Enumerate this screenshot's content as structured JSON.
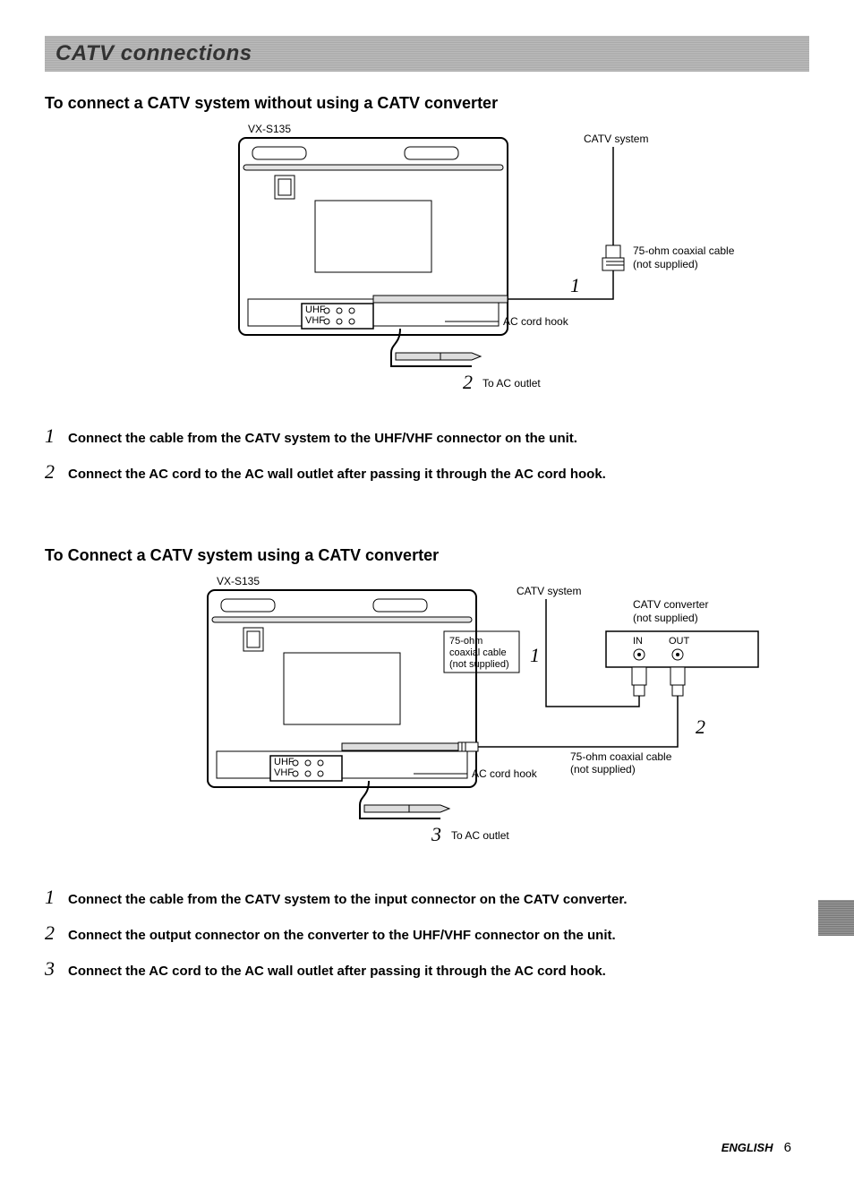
{
  "titleBar": "CATV connections",
  "section1": {
    "heading": "To connect a CATV system without using a CATV converter",
    "diagram": {
      "modelLabel": "VX-S135",
      "catvSystemLabel": "CATV system",
      "coaxLabel1": "75-ohm coaxial cable",
      "coaxLabel2": "(not supplied)",
      "cordHookLabel": "AC cord hook",
      "toAcOutletLabel": "To AC outlet",
      "stepMarker1": "1",
      "stepMarker2": "2",
      "uhfLabel": "UHF",
      "vhfLabel": "VHF"
    },
    "steps": [
      {
        "n": "1",
        "text": "Connect the cable from the CATV system to the UHF/VHF connector on the unit."
      },
      {
        "n": "2",
        "text": "Connect the AC cord to the AC wall outlet after passing it through the AC cord hook."
      }
    ]
  },
  "section2": {
    "heading": "To Connect a CATV system using a CATV converter",
    "diagram": {
      "modelLabel": "VX-S135",
      "catvSystemLabel": "CATV system",
      "converterLabel1": "CATV converter",
      "converterLabel2": "(not supplied)",
      "inLabel": "IN",
      "outLabel": "OUT",
      "coax75a1": "75-ohm",
      "coax75a2": "coaxial cable",
      "coax75a3": "(not supplied)",
      "coax75b1": "75-ohm coaxial cable",
      "coax75b2": "(not supplied)",
      "cordHookLabel": "AC cord hook",
      "toAcOutletLabel": "To AC outlet",
      "stepMarker1": "1",
      "stepMarker2": "2",
      "stepMarker3": "3",
      "uhfLabel": "UHF",
      "vhfLabel": "VHF"
    },
    "steps": [
      {
        "n": "1",
        "text": "Connect the cable from the CATV system to the input connector on the CATV converter."
      },
      {
        "n": "2",
        "text": "Connect the output connector on the converter to the UHF/VHF connector on the unit."
      },
      {
        "n": "3",
        "text": "Connect the AC cord to the AC wall outlet after passing it through the AC cord hook."
      }
    ]
  },
  "footer": {
    "lang": "ENGLISH",
    "page": "6"
  }
}
